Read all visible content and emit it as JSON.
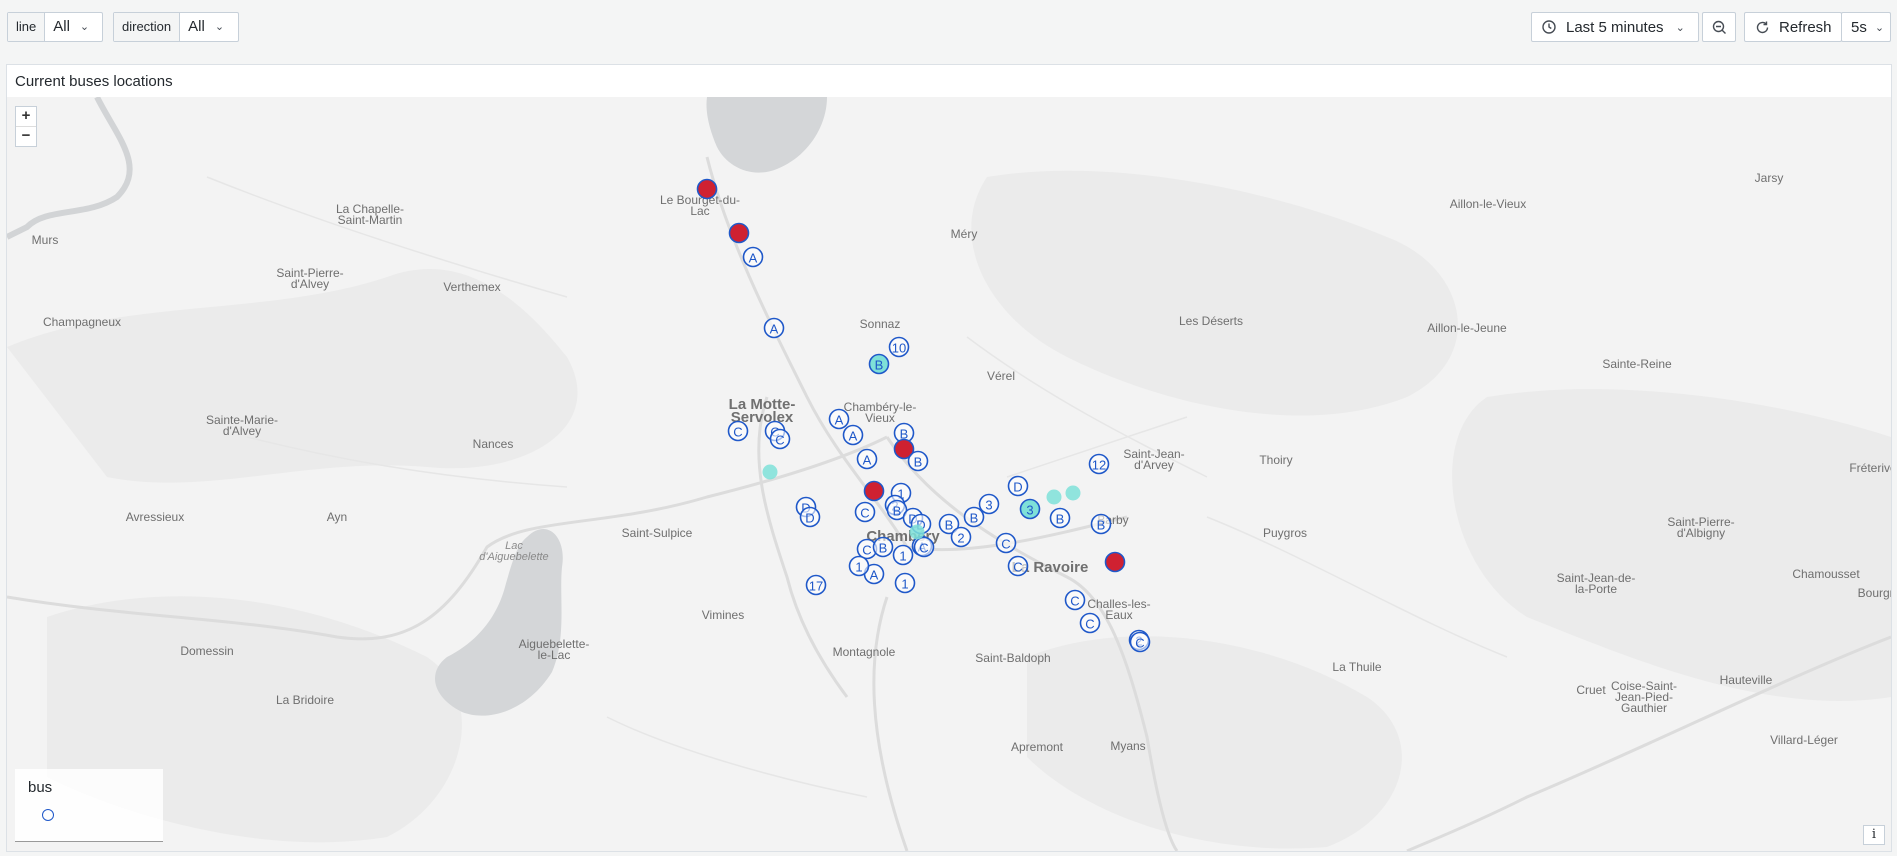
{
  "variables": {
    "line": {
      "label": "line",
      "value": "All"
    },
    "direction": {
      "label": "direction",
      "value": "All"
    }
  },
  "toolbar": {
    "time_range": "Last 5 minutes",
    "refresh_label": "Refresh",
    "refresh_interval": "5s"
  },
  "panel": {
    "title": "Current buses locations",
    "zoom_in": "+",
    "zoom_out": "−",
    "info": "i",
    "legend": {
      "title": "bus"
    }
  },
  "colors": {
    "marker_stroke": "#1f58c9",
    "active_fill": "#cf2131",
    "idle_fill": "#7ee0d8"
  },
  "map_places": [
    {
      "name": "Le Bourget-du-Lac",
      "lines": [
        "Le Bourget-du-",
        "Lac"
      ]
    },
    {
      "name": "Méry",
      "lines": [
        "Méry"
      ]
    },
    {
      "name": "La Chapelle-Saint-Martin",
      "lines": [
        "La Chapelle-",
        "Saint-Martin"
      ]
    },
    {
      "name": "Murs",
      "lines": [
        "Murs"
      ]
    },
    {
      "name": "Saint-Pierre-d'Alvey",
      "lines": [
        "Saint-Pierre-",
        "d'Alvey"
      ]
    },
    {
      "name": "Verthemex",
      "lines": [
        "Verthemex"
      ]
    },
    {
      "name": "Champagneux",
      "lines": [
        "Champagneux"
      ]
    },
    {
      "name": "Sonnaz",
      "lines": [
        "Sonnaz"
      ]
    },
    {
      "name": "Aillon-le-Vieux",
      "lines": [
        "Aillon-le-Vieux"
      ]
    },
    {
      "name": "Jarsy",
      "lines": [
        "Jarsy"
      ]
    },
    {
      "name": "Les Déserts",
      "lines": [
        "Les Déserts"
      ]
    },
    {
      "name": "Aillon-le-Jeune",
      "lines": [
        "Aillon-le-Jeune"
      ]
    },
    {
      "name": "Sainte-Reine",
      "lines": [
        "Sainte-Reine"
      ]
    },
    {
      "name": "Vérel",
      "lines": [
        "Vérel"
      ]
    },
    {
      "name": "La Motte-Servolex",
      "lines": [
        "La Motte-",
        "Servolex"
      ]
    },
    {
      "name": "Chambéry-le-Vieux",
      "lines": [
        "Chambéry-le-",
        "Vieux"
      ]
    },
    {
      "name": "Sainte-Marie-d'Alvey",
      "lines": [
        "Sainte-Marie-",
        "d'Alvey"
      ]
    },
    {
      "name": "Nances",
      "lines": [
        "Nances"
      ]
    },
    {
      "name": "Saint-Jean-d'Arvey",
      "lines": [
        "Saint-Jean-",
        "d'Arvey"
      ]
    },
    {
      "name": "Thoiry",
      "lines": [
        "Thoiry"
      ]
    },
    {
      "name": "Fréterive",
      "lines": [
        "Fréterive"
      ]
    },
    {
      "name": "Avressieux",
      "lines": [
        "Avressieux"
      ]
    },
    {
      "name": "Ayn",
      "lines": [
        "Ayn"
      ]
    },
    {
      "name": "Saint-Sulpice",
      "lines": [
        "Saint-Sulpice"
      ]
    },
    {
      "name": "Chambéry",
      "lines": [
        "Chambéry"
      ]
    },
    {
      "name": "Barby",
      "lines": [
        "Barby"
      ]
    },
    {
      "name": "Puygros",
      "lines": [
        "Puygros"
      ]
    },
    {
      "name": "Saint-Pierre-d'Albigny",
      "lines": [
        "Saint-Pierre-",
        "d'Albigny"
      ]
    },
    {
      "name": "La Ravoire",
      "lines": [
        "La Ravoire"
      ]
    },
    {
      "name": "Lac d'Aiguebelette",
      "lines": [
        "Lac",
        "d'Aiguebelette"
      ]
    },
    {
      "name": "Saint-Jean-de-la-Porte",
      "lines": [
        "Saint-Jean-de-",
        "la-Porte"
      ]
    },
    {
      "name": "Chamousset",
      "lines": [
        "Chamousset"
      ]
    },
    {
      "name": "Bourgneuf",
      "lines": [
        "Bourgn"
      ]
    },
    {
      "name": "Challes-les-Eaux",
      "lines": [
        "Challes-les-",
        "Eaux"
      ]
    },
    {
      "name": "Vimines",
      "lines": [
        "Vimines"
      ]
    },
    {
      "name": "Domessin",
      "lines": [
        "Domessin"
      ]
    },
    {
      "name": "Aiguebelette-le-Lac",
      "lines": [
        "Aiguebelette-",
        "le-Lac"
      ]
    },
    {
      "name": "Montagnole",
      "lines": [
        "Montagnole"
      ]
    },
    {
      "name": "Saint-Baldoph",
      "lines": [
        "Saint-Baldoph"
      ]
    },
    {
      "name": "La Thuile",
      "lines": [
        "La Thuile"
      ]
    },
    {
      "name": "Hauteville",
      "lines": [
        "Hauteville"
      ]
    },
    {
      "name": "Cruet",
      "lines": [
        "Cruet"
      ]
    },
    {
      "name": "Coise-Saint-Jean-Pied-Gauthier",
      "lines": [
        "Coise-Saint-",
        "Jean-Pied-",
        "Gauthier"
      ]
    },
    {
      "name": "La Bridoire",
      "lines": [
        "La Bridoire"
      ]
    },
    {
      "name": "Apremont",
      "lines": [
        "Apremont"
      ]
    },
    {
      "name": "Myans",
      "lines": [
        "Myans"
      ]
    },
    {
      "name": "Villard-Léger",
      "lines": [
        "Villard-Léger"
      ]
    }
  ],
  "buses": [
    {
      "line": "",
      "state": "active"
    },
    {
      "line": "",
      "state": "active"
    },
    {
      "line": "A",
      "state": "normal"
    },
    {
      "line": "A",
      "state": "normal"
    },
    {
      "line": "10",
      "state": "normal"
    },
    {
      "line": "B",
      "state": "idle"
    },
    {
      "line": "A",
      "state": "normal"
    },
    {
      "line": "C",
      "state": "normal"
    },
    {
      "line": "C",
      "state": "normal"
    },
    {
      "line": "C",
      "state": "normal"
    },
    {
      "line": "A",
      "state": "normal"
    },
    {
      "line": "B",
      "state": "normal"
    },
    {
      "line": "",
      "state": "active"
    },
    {
      "line": "A",
      "state": "normal"
    },
    {
      "line": "B",
      "state": "normal"
    },
    {
      "line": "",
      "state": "idle_dot"
    },
    {
      "line": "",
      "state": "active"
    },
    {
      "line": "1",
      "state": "normal"
    },
    {
      "line": "D",
      "state": "normal"
    },
    {
      "line": "D",
      "state": "normal"
    },
    {
      "line": "C",
      "state": "normal"
    },
    {
      "line": "2",
      "state": "normal"
    },
    {
      "line": "B",
      "state": "normal"
    },
    {
      "line": "D",
      "state": "normal"
    },
    {
      "line": "D",
      "state": "normal"
    },
    {
      "line": "B",
      "state": "normal"
    },
    {
      "line": "2",
      "state": "normal"
    },
    {
      "line": "B",
      "state": "normal"
    },
    {
      "line": "3",
      "state": "normal"
    },
    {
      "line": "3",
      "state": "idle"
    },
    {
      "line": "D",
      "state": "normal"
    },
    {
      "line": "",
      "state": "idle_dot"
    },
    {
      "line": "",
      "state": "idle_dot"
    },
    {
      "line": "12",
      "state": "normal"
    },
    {
      "line": "B",
      "state": "normal"
    },
    {
      "line": "B",
      "state": "normal"
    },
    {
      "line": "C",
      "state": "normal"
    },
    {
      "line": "C",
      "state": "normal"
    },
    {
      "line": "",
      "state": "active"
    },
    {
      "line": "C",
      "state": "normal"
    },
    {
      "line": "B",
      "state": "normal"
    },
    {
      "line": "A",
      "state": "normal"
    },
    {
      "line": "1",
      "state": "normal"
    },
    {
      "line": "1",
      "state": "normal"
    },
    {
      "line": "A",
      "state": "normal"
    },
    {
      "line": "C",
      "state": "normal"
    },
    {
      "line": "1",
      "state": "normal"
    },
    {
      "line": "17",
      "state": "normal"
    },
    {
      "line": "C",
      "state": "normal"
    },
    {
      "line": "C",
      "state": "normal"
    },
    {
      "line": "2",
      "state": "normal"
    },
    {
      "line": "C",
      "state": "normal"
    },
    {
      "line": "",
      "state": "idle_dot"
    }
  ]
}
